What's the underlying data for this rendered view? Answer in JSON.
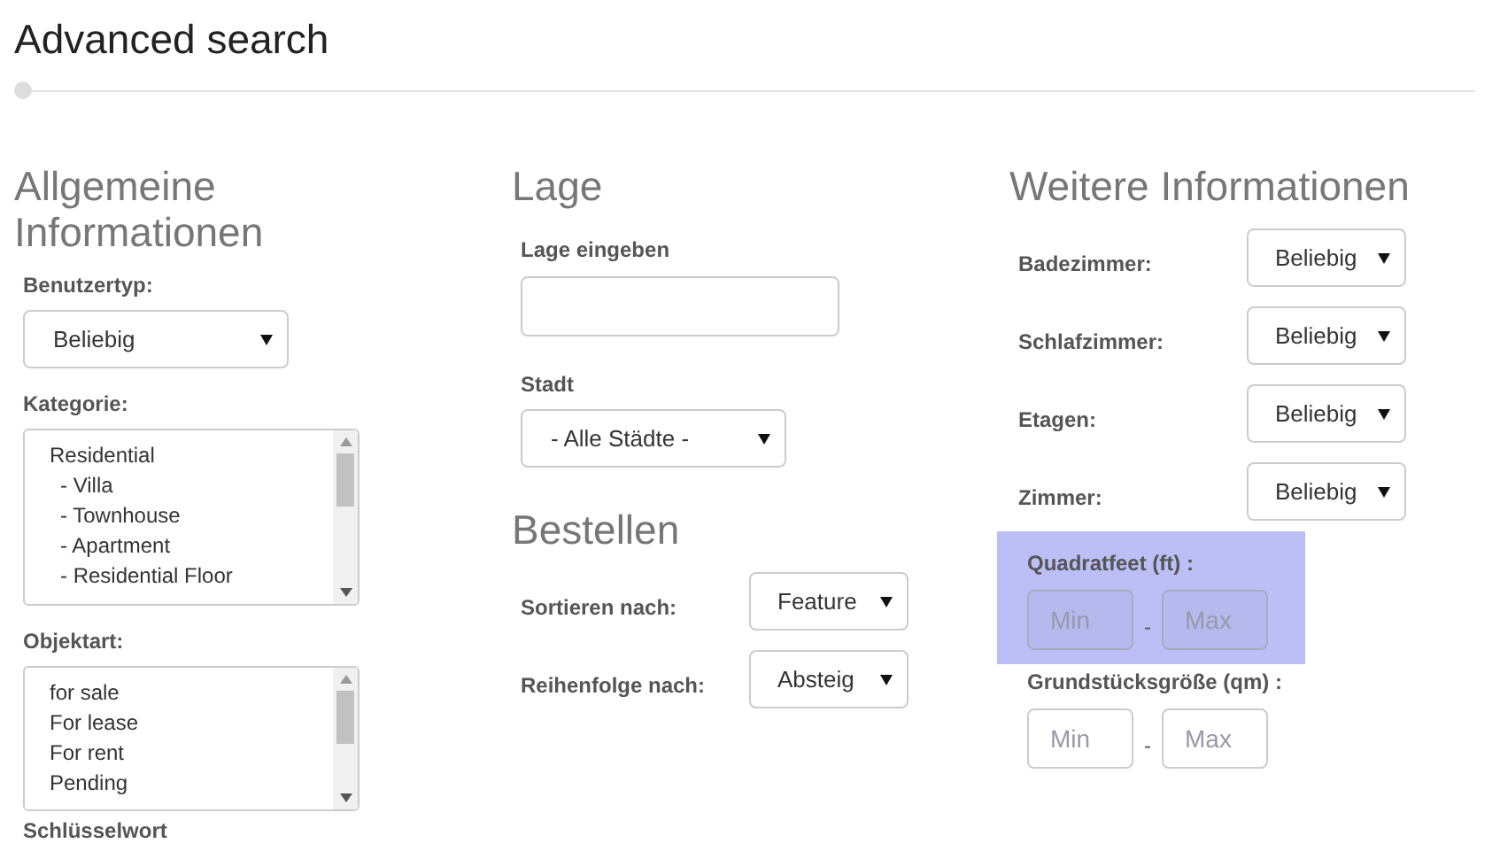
{
  "title": "Advanced search",
  "columns": [
    {
      "heading": "Allgemeine Informationen",
      "fields": [
        {
          "kind": "select",
          "label": "Benutzertyp:",
          "value": "Beliebig"
        },
        {
          "kind": "listbox",
          "label": "Kategorie:",
          "items": [
            {
              "label": "Residential",
              "children": [
                {
                  "label": "- Villa"
                },
                {
                  "label": "- Townhouse"
                },
                {
                  "label": "- Apartment"
                },
                {
                  "label": "- Residential Floor"
                }
              ]
            }
          ]
        },
        {
          "kind": "listbox",
          "label": "Objektart:",
          "items": [
            {
              "label": "for sale"
            },
            {
              "label": "For lease"
            },
            {
              "label": "For rent"
            },
            {
              "label": "Pending"
            }
          ]
        },
        {
          "kind": "caption",
          "label": "Schlüsselwort"
        }
      ]
    },
    {
      "heading": "Lage",
      "fields": [
        {
          "kind": "text",
          "label": "Lage eingeben"
        },
        {
          "kind": "select",
          "label": "Stadt",
          "value": "- Alle Städte -"
        }
      ]
    },
    {
      "heading": "Bestellen",
      "fields": [
        {
          "kind": "inline-select",
          "label": "Sortieren nach:",
          "value": "Feature"
        },
        {
          "kind": "inline-select",
          "label": "Reihenfolge nach:",
          "value": "Absteig"
        }
      ]
    },
    {
      "heading": "Weitere Informationen",
      "fields": [
        {
          "kind": "inline-select",
          "label": "Badezimmer:",
          "value": "Beliebig"
        },
        {
          "kind": "inline-select",
          "label": "Schlafzimmer:",
          "value": "Beliebig"
        },
        {
          "kind": "inline-select",
          "label": "Etagen:",
          "value": "Beliebig"
        },
        {
          "kind": "inline-select",
          "label": "Zimmer:",
          "value": "Beliebig"
        },
        {
          "kind": "range",
          "label": "Quadratfeet (ft) :",
          "min_placeholder": "Min",
          "separator": "-",
          "max_placeholder": "Max",
          "highlighted": true
        },
        {
          "kind": "range",
          "label": "Grundstücksgröße (qm) :",
          "min_placeholder": "Min",
          "separator": "-",
          "max_placeholder": "Max",
          "highlighted": false
        }
      ]
    }
  ]
}
